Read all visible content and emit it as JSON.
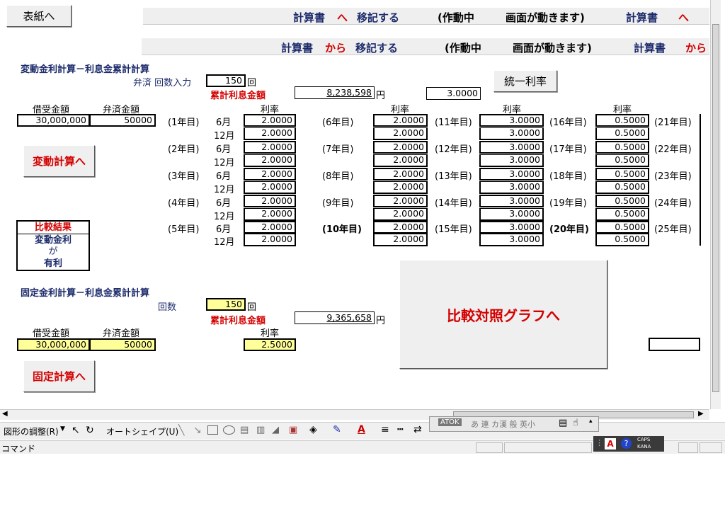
{
  "buttons": {
    "cover": "表紙へ",
    "uniform_rate": "統一利率",
    "variable_calc": "変動計算へ",
    "fixed_calc": "固定計算へ",
    "graph": "比較対照グラフへ"
  },
  "banner1": {
    "text_a": "計算書",
    "arrow": "へ",
    "text_b": "移記する",
    "status": "(作動中",
    "moving": "画面が動きます)",
    "repeat_a": "計算書",
    "repeat_arrow": "へ"
  },
  "banner2": {
    "text_a": "計算書",
    "from": "から",
    "text_b": "移記する",
    "status": "(作動中",
    "moving": "画面が動きます)",
    "repeat_a": "計算書",
    "repeat_from": "から"
  },
  "variable": {
    "title": "変動金利計算－利息金累計計算",
    "count_label": "弁済 回数入力",
    "count": "150",
    "count_unit": "回",
    "total_label": "累計利息金額",
    "total": "8,238,598",
    "total_unit": "円",
    "uniform_value": "3.0000",
    "hdr_loan": "借受金額",
    "hdr_repay": "弁済金額",
    "loan": "30,000,000",
    "repay": "50000",
    "rate_header": "利率"
  },
  "schedule": {
    "years_c1": [
      "(1年目)",
      "(2年目)",
      "(3年目)",
      "(4年目)",
      "(5年目)"
    ],
    "years_c2": [
      "(6年目)",
      "(7年目)",
      "(8年目)",
      "(9年目)",
      "(10年目)"
    ],
    "years_c3": [
      "(11年目)",
      "(12年目)",
      "(13年目)",
      "(14年目)",
      "(15年目)"
    ],
    "years_c4": [
      "(16年目)",
      "(17年目)",
      "(18年目)",
      "(19年目)",
      "(20年目)"
    ],
    "years_c5": [
      "(21年目)",
      "(22年目)",
      "(23年目)",
      "(24年目)",
      "(25年目)"
    ],
    "month_june": "6月",
    "month_dec": "12月",
    "rates_c1": [
      "2.0000",
      "2.0000",
      "2.0000",
      "2.0000",
      "2.0000",
      "2.0000",
      "2.0000",
      "2.0000",
      "2.0000",
      "2.0000"
    ],
    "rates_c2": [
      "2.0000",
      "2.0000",
      "2.0000",
      "2.0000",
      "2.0000",
      "2.0000",
      "2.0000",
      "2.0000",
      "2.0000",
      "2.0000"
    ],
    "rates_c3": [
      "3.0000",
      "3.0000",
      "3.0000",
      "3.0000",
      "3.0000",
      "3.0000",
      "3.0000",
      "3.0000",
      "3.0000",
      "3.0000"
    ],
    "rates_c4": [
      "0.5000",
      "0.5000",
      "0.5000",
      "0.5000",
      "0.5000",
      "0.5000",
      "0.5000",
      "0.5000",
      "0.5000",
      "0.5000"
    ]
  },
  "comparison": {
    "title": "比較結果",
    "line1": "変動金利",
    "line2": "が",
    "line3": "有利"
  },
  "fixed": {
    "title": "固定金利計算－利息金累計計算",
    "count_label": "回数",
    "count": "150",
    "count_unit": "回",
    "total_label": "累計利息金額",
    "total": "9,365,658",
    "total_unit": "円",
    "hdr_loan": "借受金額",
    "hdr_repay": "弁済金額",
    "loan": "30,000,000",
    "repay": "50000",
    "rate_header": "利率",
    "rate": "2.5000"
  },
  "toolbar": {
    "draw_adjust": "図形の調整(R)",
    "autoshape": "オートシェイプ(U)",
    "atok": "ATOK",
    "ime_items": "あ 連 カ漢 般 英小",
    "caps": "CAPS",
    "kana": "KANA"
  },
  "status": {
    "command": "コマンド"
  },
  "colors": {
    "navy": "#1c2b6b",
    "red": "#d40000",
    "yellow_cell": "#ffff99",
    "button_gray": "#efefef"
  }
}
